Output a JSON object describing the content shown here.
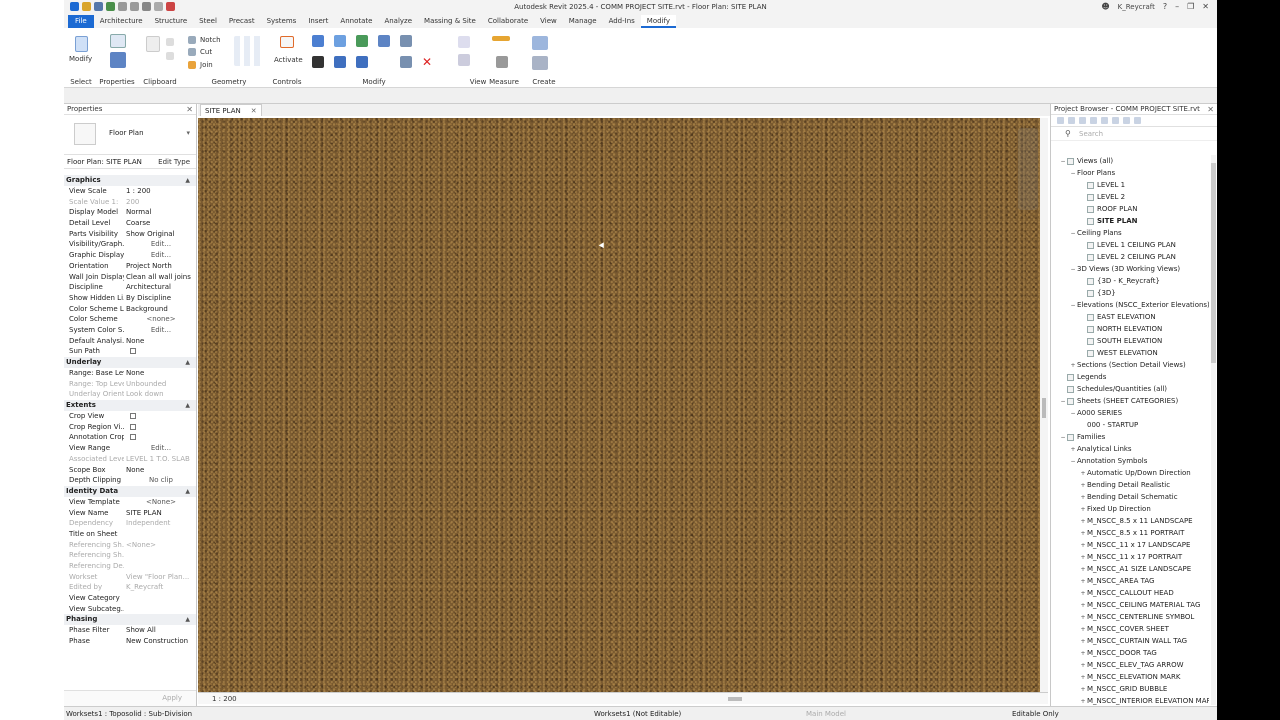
{
  "window": {
    "title": "Autodesk Revit 2025.4 - COMM PROJECT SITE.rvt - Floor Plan: SITE PLAN",
    "user": "K_Reycraft"
  },
  "ribbon": {
    "tabs": [
      "File",
      "Architecture",
      "Structure",
      "Steel",
      "Precast",
      "Systems",
      "Insert",
      "Annotate",
      "Analyze",
      "Massing & Site",
      "Collaborate",
      "View",
      "Manage",
      "Add-Ins",
      "Modify"
    ],
    "active_tab": "Modify",
    "groups": {
      "select": "Select",
      "properties": "Properties",
      "clipboard": "Clipboard",
      "geometry": "Geometry",
      "controls": "Controls",
      "modify": "Modify",
      "view": "View",
      "measure": "Measure",
      "create": "Create"
    },
    "buttons": {
      "modify": "Modify",
      "notch": "Notch",
      "cut": "Cut",
      "join": "Join",
      "activate": "Activate"
    }
  },
  "properties": {
    "title": "Properties",
    "type_name": "Floor Plan",
    "instance_selector": "Floor Plan: SITE PLAN",
    "edit_type": "Edit Type",
    "apply": "Apply",
    "sections": [
      {
        "name": "Graphics",
        "rows": [
          {
            "name": "View Scale",
            "value": "1 : 200"
          },
          {
            "name": "Scale Value   1:",
            "value": "200",
            "disabled": true
          },
          {
            "name": "Display Model",
            "value": "Normal"
          },
          {
            "name": "Detail Level",
            "value": "Coarse"
          },
          {
            "name": "Parts Visibility",
            "value": "Show Original"
          },
          {
            "name": "Visibility/Graph...",
            "value": "Edit...",
            "button": true
          },
          {
            "name": "Graphic Display...",
            "value": "Edit...",
            "button": true
          },
          {
            "name": "Orientation",
            "value": "Project North"
          },
          {
            "name": "Wall Join Display",
            "value": "Clean all wall joins"
          },
          {
            "name": "Discipline",
            "value": "Architectural"
          },
          {
            "name": "Show Hidden Li...",
            "value": "By Discipline"
          },
          {
            "name": "Color Scheme L...",
            "value": "Background"
          },
          {
            "name": "Color Scheme",
            "value": "<none>",
            "button": true
          },
          {
            "name": "System Color S...",
            "value": "Edit...",
            "button": true
          },
          {
            "name": "Default Analysi...",
            "value": "None"
          },
          {
            "name": "Sun Path",
            "value": "",
            "checkbox": true
          }
        ]
      },
      {
        "name": "Underlay",
        "rows": [
          {
            "name": "Range: Base Level",
            "value": "None"
          },
          {
            "name": "Range: Top Level",
            "value": "Unbounded",
            "disabled": true
          },
          {
            "name": "Underlay Orient...",
            "value": "Look down",
            "disabled": true
          }
        ]
      },
      {
        "name": "Extents",
        "rows": [
          {
            "name": "Crop View",
            "value": "",
            "checkbox": true
          },
          {
            "name": "Crop Region Vi...",
            "value": "",
            "checkbox": true
          },
          {
            "name": "Annotation Crop",
            "value": "",
            "checkbox": true
          },
          {
            "name": "View Range",
            "value": "Edit...",
            "button": true
          },
          {
            "name": "Associated Level",
            "value": "LEVEL 1 T.O. SLAB",
            "disabled": true
          },
          {
            "name": "Scope Box",
            "value": "None"
          },
          {
            "name": "Depth Clipping",
            "value": "No clip",
            "button": true
          }
        ]
      },
      {
        "name": "Identity Data",
        "rows": [
          {
            "name": "View Template",
            "value": "<None>",
            "button": true
          },
          {
            "name": "View Name",
            "value": "SITE PLAN"
          },
          {
            "name": "Dependency",
            "value": "Independent",
            "disabled": true
          },
          {
            "name": "Title on Sheet",
            "value": ""
          },
          {
            "name": "Referencing Sh...",
            "value": "<None>",
            "disabled": true
          },
          {
            "name": "Referencing Sh...",
            "value": "",
            "disabled": true
          },
          {
            "name": "Referencing De...",
            "value": "",
            "disabled": true
          },
          {
            "name": "Workset",
            "value": "View \"Floor Plan...",
            "disabled": true
          },
          {
            "name": "Edited by",
            "value": "K_Reycraft",
            "disabled": true
          },
          {
            "name": "View Category",
            "value": ""
          },
          {
            "name": "View Subcateg...",
            "value": ""
          }
        ]
      },
      {
        "name": "Phasing",
        "rows": [
          {
            "name": "Phase Filter",
            "value": "Show All"
          },
          {
            "name": "Phase",
            "value": "New Construction"
          }
        ]
      }
    ]
  },
  "view": {
    "tab_label": "SITE PLAN",
    "scale_label": "1 : 200"
  },
  "browser": {
    "title": "Project Browser - COMM PROJECT SITE.rvt",
    "search_placeholder": "Search",
    "tree": [
      {
        "label": "Views (all)",
        "level": 0,
        "exp": "−",
        "icon": true
      },
      {
        "label": "Floor Plans",
        "level": 1,
        "exp": "−"
      },
      {
        "label": "LEVEL 1",
        "level": 2,
        "icon": true
      },
      {
        "label": "LEVEL 2",
        "level": 2,
        "icon": true
      },
      {
        "label": "ROOF PLAN",
        "level": 2,
        "icon": true
      },
      {
        "label": "SITE PLAN",
        "level": 2,
        "icon": true,
        "bold": true
      },
      {
        "label": "Ceiling Plans",
        "level": 1,
        "exp": "−"
      },
      {
        "label": "LEVEL 1 CEILING PLAN",
        "level": 2,
        "icon": true
      },
      {
        "label": "LEVEL 2 CEILING PLAN",
        "level": 2,
        "icon": true
      },
      {
        "label": "3D Views (3D Working Views)",
        "level": 1,
        "exp": "−"
      },
      {
        "label": "{3D - K_Reycraft}",
        "level": 2,
        "icon": true
      },
      {
        "label": "{3D}",
        "level": 2,
        "icon": true
      },
      {
        "label": "Elevations (NSCC_Exterior Elevations)",
        "level": 1,
        "exp": "−"
      },
      {
        "label": "EAST ELEVATION",
        "level": 2,
        "icon": true
      },
      {
        "label": "NORTH ELEVATION",
        "level": 2,
        "icon": true
      },
      {
        "label": "SOUTH ELEVATION",
        "level": 2,
        "icon": true
      },
      {
        "label": "WEST ELEVATION",
        "level": 2,
        "icon": true
      },
      {
        "label": "Sections (Section Detail Views)",
        "level": 1,
        "exp": "+"
      },
      {
        "label": "Legends",
        "level": 0,
        "icon": true
      },
      {
        "label": "Schedules/Quantities (all)",
        "level": 0,
        "icon": true
      },
      {
        "label": "Sheets (SHEET CATEGORIES)",
        "level": 0,
        "exp": "−",
        "icon": true
      },
      {
        "label": "A000 SERIES",
        "level": 1,
        "exp": "−"
      },
      {
        "label": "000 - STARTUP",
        "level": 2
      },
      {
        "label": "Families",
        "level": 0,
        "exp": "−",
        "icon": true
      },
      {
        "label": "Analytical Links",
        "level": 1,
        "exp": "+"
      },
      {
        "label": "Annotation Symbols",
        "level": 1,
        "exp": "−"
      },
      {
        "label": "Automatic Up/Down Direction",
        "level": 2,
        "exp": "+"
      },
      {
        "label": "Bending Detail Realistic",
        "level": 2,
        "exp": "+"
      },
      {
        "label": "Bending Detail Schematic",
        "level": 2,
        "exp": "+"
      },
      {
        "label": "Fixed Up Direction",
        "level": 2,
        "exp": "+"
      },
      {
        "label": "M_NSCC_8.5 x 11 LANDSCAPE",
        "level": 2,
        "exp": "+"
      },
      {
        "label": "M_NSCC_8.5 x 11 PORTRAIT",
        "level": 2,
        "exp": "+"
      },
      {
        "label": "M_NSCC_11 x 17 LANDSCAPE",
        "level": 2,
        "exp": "+"
      },
      {
        "label": "M_NSCC_11 x 17 PORTRAIT",
        "level": 2,
        "exp": "+"
      },
      {
        "label": "M_NSCC_A1 SIZE LANDSCAPE",
        "level": 2,
        "exp": "+"
      },
      {
        "label": "M_NSCC_AREA TAG",
        "level": 2,
        "exp": "+"
      },
      {
        "label": "M_NSCC_CALLOUT HEAD",
        "level": 2,
        "exp": "+"
      },
      {
        "label": "M_NSCC_CEILING MATERIAL TAG",
        "level": 2,
        "exp": "+"
      },
      {
        "label": "M_NSCC_CENTERLINE SYMBOL",
        "level": 2,
        "exp": "+"
      },
      {
        "label": "M_NSCC_COVER SHEET",
        "level": 2,
        "exp": "+"
      },
      {
        "label": "M_NSCC_CURTAIN WALL TAG",
        "level": 2,
        "exp": "+"
      },
      {
        "label": "M_NSCC_DOOR TAG",
        "level": 2,
        "exp": "+"
      },
      {
        "label": "M_NSCC_ELEV_TAG ARROW",
        "level": 2,
        "exp": "+"
      },
      {
        "label": "M_NSCC_ELEVATION MARK",
        "level": 2,
        "exp": "+"
      },
      {
        "label": "M_NSCC_GRID BUBBLE",
        "level": 2,
        "exp": "+"
      },
      {
        "label": "M_NSCC_INTERIOR ELEVATION MARK",
        "level": 2,
        "exp": "+"
      }
    ]
  },
  "status": {
    "left": "Worksets1 : Toposolid : Sub-Division",
    "workset": "Worksets1 (Not Editable)",
    "zero": ":0",
    "main_model": "Main Model",
    "editable": "Editable Only"
  },
  "colors": {
    "accent": "#1c6ad3",
    "terrain": "#7a5a30"
  }
}
